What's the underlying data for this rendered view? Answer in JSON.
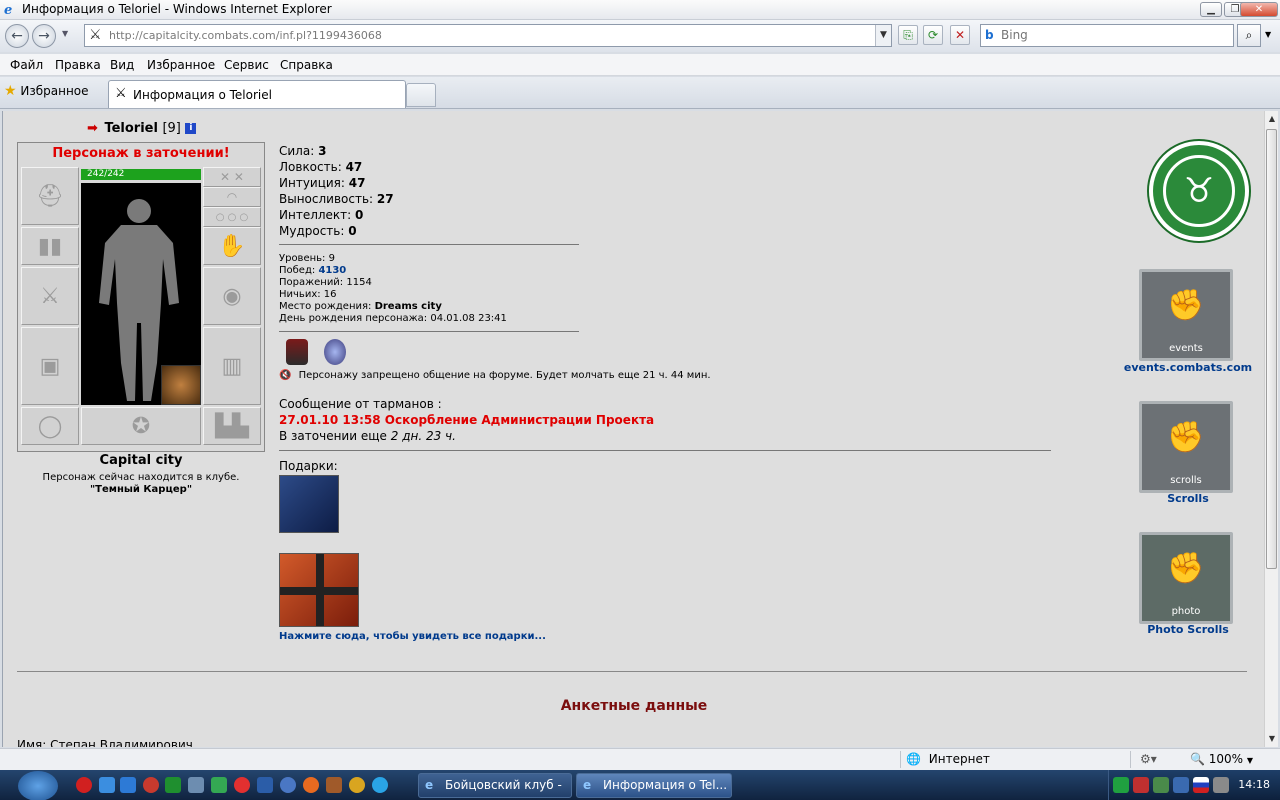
{
  "window": {
    "title": "Информация о Teloriel - Windows Internet Explorer",
    "url": "http://capitalcity.combats.com/inf.pl?1199436068",
    "search_placeholder": "Bing"
  },
  "menu": [
    "Файл",
    "Правка",
    "Вид",
    "Избранное",
    "Сервис",
    "Справка"
  ],
  "tabs": {
    "favorites": "Избранное",
    "active": "Информация о Teloriel"
  },
  "character": {
    "name": "Teloriel",
    "level": "[9]",
    "jail_status": "Персонаж в заточении!",
    "hp": "242/242",
    "city": "Capital city",
    "club_line": "Персонаж сейчас находится в клубе.",
    "club_name": "\"Темный Карцер\""
  },
  "stats": [
    {
      "label": "Сила:",
      "value": "3"
    },
    {
      "label": "Ловкость:",
      "value": "47"
    },
    {
      "label": "Интуиция:",
      "value": "47"
    },
    {
      "label": "Выносливость:",
      "value": "27"
    },
    {
      "label": "Интеллект:",
      "value": "0"
    },
    {
      "label": "Мудрость:",
      "value": "0"
    }
  ],
  "info": {
    "level_label": "Уровень:",
    "level": "9",
    "wins_label": "Побед:",
    "wins": "4130",
    "losses_label": "Поражений:",
    "losses": "1154",
    "draws_label": "Ничьих:",
    "draws": "16",
    "birthplace_label": "Место рождения:",
    "birthplace": "Dreams city",
    "birthday_label": "День рождения персонажа:",
    "birthday": "04.01.08 23:41"
  },
  "forum_ban": "Персонажу запрещено общение на форуме. Будет молчать еще 21 ч. 44 мин.",
  "tarmans": {
    "heading": "Сообщение от тарманов :",
    "message": "27.01.10 13:58 Оскорбление Администрации Проекта",
    "jail_prefix": "В заточении еще",
    "jail_left": "2 дн. 23 ч."
  },
  "gifts": {
    "heading": "Подарки:",
    "see_all": "Нажмите сюда, чтобы увидеть все подарки..."
  },
  "profile": {
    "heading": "Анкетные данные",
    "name_line": "Имя: Степан Владимирович"
  },
  "right": {
    "events_text": "events",
    "events_label": "events.combats.com",
    "scrolls_text": "scrolls",
    "scrolls_label": "Scrolls",
    "photo_text": "photo",
    "photo_label": "Photo Scrolls"
  },
  "statusbar": {
    "zone": "Интернет",
    "zoom": "100%"
  },
  "taskbar": {
    "task1": "Бойцовский клуб - ...",
    "task2": "Информация о Tel...",
    "clock": "14:18"
  }
}
